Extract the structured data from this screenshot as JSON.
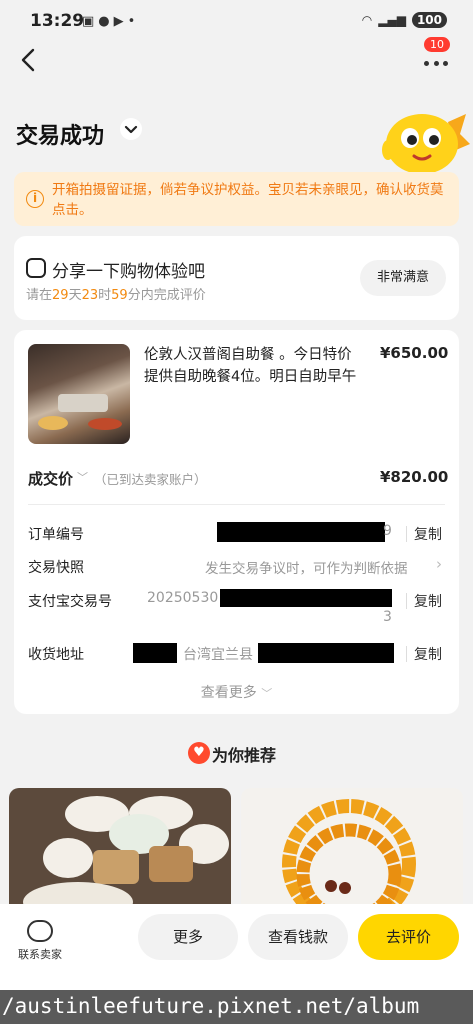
{
  "status_bar": {
    "time": "13:29",
    "battery": "100",
    "icons": [
      "message-icon",
      "facebook-icon",
      "video-icon",
      "wifi-icon",
      "signal-icon"
    ]
  },
  "nav": {
    "notification_count": "10"
  },
  "header": {
    "title": "交易成功"
  },
  "notice": {
    "icon": "info-icon",
    "text": "开箱拍摄留证据，倘若争议护权益。宝贝若未亲眼见，确认收货莫点击。"
  },
  "share": {
    "title": "分享一下购物体验吧",
    "sub_prefix": "请在",
    "days": "29",
    "days_unit": "天",
    "hours": "23",
    "hours_unit": "时",
    "minutes": "59",
    "sub_suffix": "分内完成评价",
    "button": "非常满意"
  },
  "order": {
    "product_title": "伦敦人汉普阁自助餐 。今日特价 提供自助晚餐4位。明日自助早午",
    "product_price": "¥650.00",
    "deal_label": "成交价",
    "deal_note": "（已到达卖家账户）",
    "deal_price": "¥820.00",
    "rows": {
      "order_no_label": "订单编号",
      "order_no_tail": "9",
      "snapshot_label": "交易快照",
      "snapshot_value": "发生交易争议时，可作为判断依据",
      "alipay_label": "支付宝交易号",
      "alipay_prefix": "20250530",
      "alipay_tail": "3",
      "address_label": "收货地址",
      "address_value": "台湾宜兰县",
      "copy": "复制"
    },
    "see_more": "查看更多"
  },
  "recommend": {
    "heading": "为你推荐"
  },
  "bottom_bar": {
    "contact_label": "联系卖家",
    "more": "更多",
    "view_refund": "查看钱款",
    "review": "去评价"
  },
  "watermark": "/austinleefuture.pixnet.net/album",
  "colors": {
    "accent_yellow": "#ffd600",
    "notice_orange": "#f07a14",
    "badge_red": "#ff3b30"
  }
}
